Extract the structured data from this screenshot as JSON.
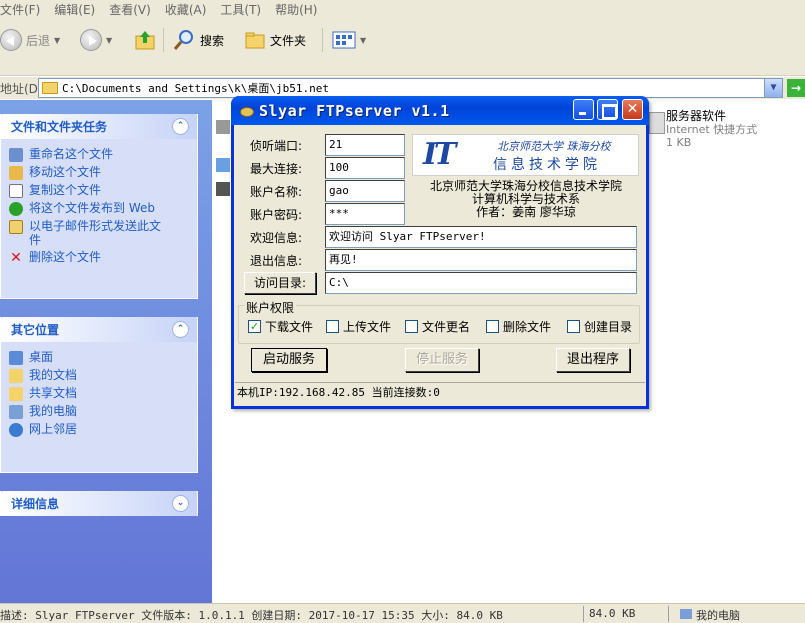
{
  "menubar": {
    "items": [
      "文件(F)",
      "编辑(E)",
      "查看(V)",
      "收藏(A)",
      "工具(T)",
      "帮助(H)"
    ]
  },
  "toolbar": {
    "back_label": "后退",
    "search_label": "搜索",
    "folders_label": "文件夹"
  },
  "addressbar": {
    "label": "地址(D)",
    "path": "C:\\Documents and Settings\\k\\桌面\\jb51.net"
  },
  "left_pane": {
    "tasks": {
      "title": "文件和文件夹任务",
      "items": [
        "重命名这个文件",
        "移动这个文件",
        "复制这个文件",
        "将这个文件发布到 Web",
        "以电子邮件形式发送此文件",
        "删除这个文件"
      ]
    },
    "places": {
      "title": "其它位置",
      "items": [
        "桌面",
        "我的文档",
        "共享文档",
        "我的电脑",
        "网上邻居"
      ]
    },
    "details": {
      "title": "详细信息"
    }
  },
  "file_item": {
    "name": "服务器软件",
    "type": "Internet 快捷方式",
    "size": "1 KB"
  },
  "statusbar": {
    "description": "描述: Slyar FTPserver 文件版本: 1.0.1.1 创建日期: 2017-10-17 15:35 大小: 84.0 KB",
    "size": "84.0 KB",
    "zone": "我的电脑"
  },
  "dialog": {
    "title": "Slyar FTPserver v1.1",
    "fields": {
      "port_label": "侦听端口:",
      "port_value": "21",
      "maxconn_label": "最大连接:",
      "maxconn_value": "100",
      "account_label": "账户名称:",
      "account_value": "gao",
      "password_label": "账户密码:",
      "password_value": "***",
      "welcome_label": "欢迎信息:",
      "welcome_value": "欢迎访问 Slyar FTPserver!",
      "exit_label": "退出信息:",
      "exit_value": "再见!",
      "dir_button": "访问目录:",
      "dir_value": "C:\\"
    },
    "logo": {
      "mark": "IT",
      "line1": "北京师范大学 珠海分校",
      "line2": "信息技术学院"
    },
    "info": {
      "line1": "北京师范大学珠海分校信息技术学院",
      "line2": "计算机科学与技术系",
      "line3": "作者：姜南 廖华琼"
    },
    "permissions": {
      "title": "账户权限",
      "items": [
        {
          "label": "下载文件",
          "checked": "✓"
        },
        {
          "label": "上传文件",
          "checked": ""
        },
        {
          "label": "文件更名",
          "checked": ""
        },
        {
          "label": "删除文件",
          "checked": ""
        },
        {
          "label": "创建目录",
          "checked": ""
        }
      ]
    },
    "buttons": {
      "start": "启动服务",
      "stop": "停止服务",
      "exit": "退出程序"
    },
    "status": "本机IP:192.168.42.85 当前连接数:0"
  }
}
